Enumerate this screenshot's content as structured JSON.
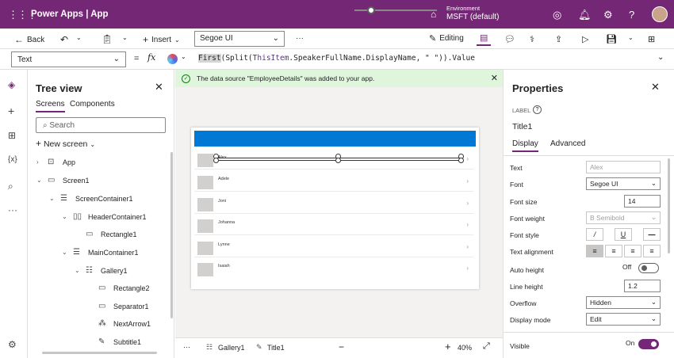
{
  "topbar": {
    "app_title": "Power Apps  |  App",
    "environment_label": "Environment",
    "environment_name": "MSFT (default)"
  },
  "cmdbar": {
    "back": "Back",
    "insert": "Insert",
    "font": "Segoe UI",
    "more": "···",
    "editing": "Editing"
  },
  "formulabar": {
    "property": "Text",
    "equals": "=",
    "fx": "fx",
    "formula_fn": "First",
    "formula_mid": "(Split(",
    "formula_this": "ThisItem",
    "formula_rest": ".SpeakerFullName.DisplayName, \" \")).Value"
  },
  "tree": {
    "title": "Tree view",
    "tab_screens": "Screens",
    "tab_components": "Components",
    "search_placeholder": "Search",
    "new_screen": "New screen",
    "nodes": [
      "App",
      "Screen1",
      "ScreenContainer1",
      "HeaderContainer1",
      "Rectangle1",
      "MainContainer1",
      "Gallery1",
      "Rectangle2",
      "Separator1",
      "NextArrow1",
      "Subtitle1"
    ]
  },
  "notification": "The data source \"EmployeeDetails\" was added to your app.",
  "gallery": {
    "names": [
      "Alex",
      "Adele",
      "Joni",
      "Johanna",
      "Lynne",
      "Isaiah"
    ]
  },
  "bottombar": {
    "more": "···",
    "gallery": "Gallery1",
    "title": "Title1",
    "zoom": "40%"
  },
  "props": {
    "title": "Properties",
    "label": "LABEL",
    "name": "Title1",
    "tab_display": "Display",
    "tab_advanced": "Advanced",
    "text_label": "Text",
    "text_value": "Alex",
    "font_label": "Font",
    "font_value": "Segoe UI",
    "fontsize_label": "Font size",
    "fontsize_value": "14",
    "fontweight_label": "Font weight",
    "fontweight_value": "B  Semibold",
    "fontstyle_label": "Font style",
    "textalign_label": "Text alignment",
    "autoheight_label": "Auto height",
    "autoheight_value": "Off",
    "lineheight_label": "Line height",
    "lineheight_value": "1.2",
    "overflow_label": "Overflow",
    "overflow_value": "Hidden",
    "displaymode_label": "Display mode",
    "displaymode_value": "Edit",
    "visible_label": "Visible",
    "visible_value": "On"
  },
  "colors": {
    "brand": "#742774",
    "header_blue": "#0078d4",
    "notif_bg": "#dff6dd"
  }
}
